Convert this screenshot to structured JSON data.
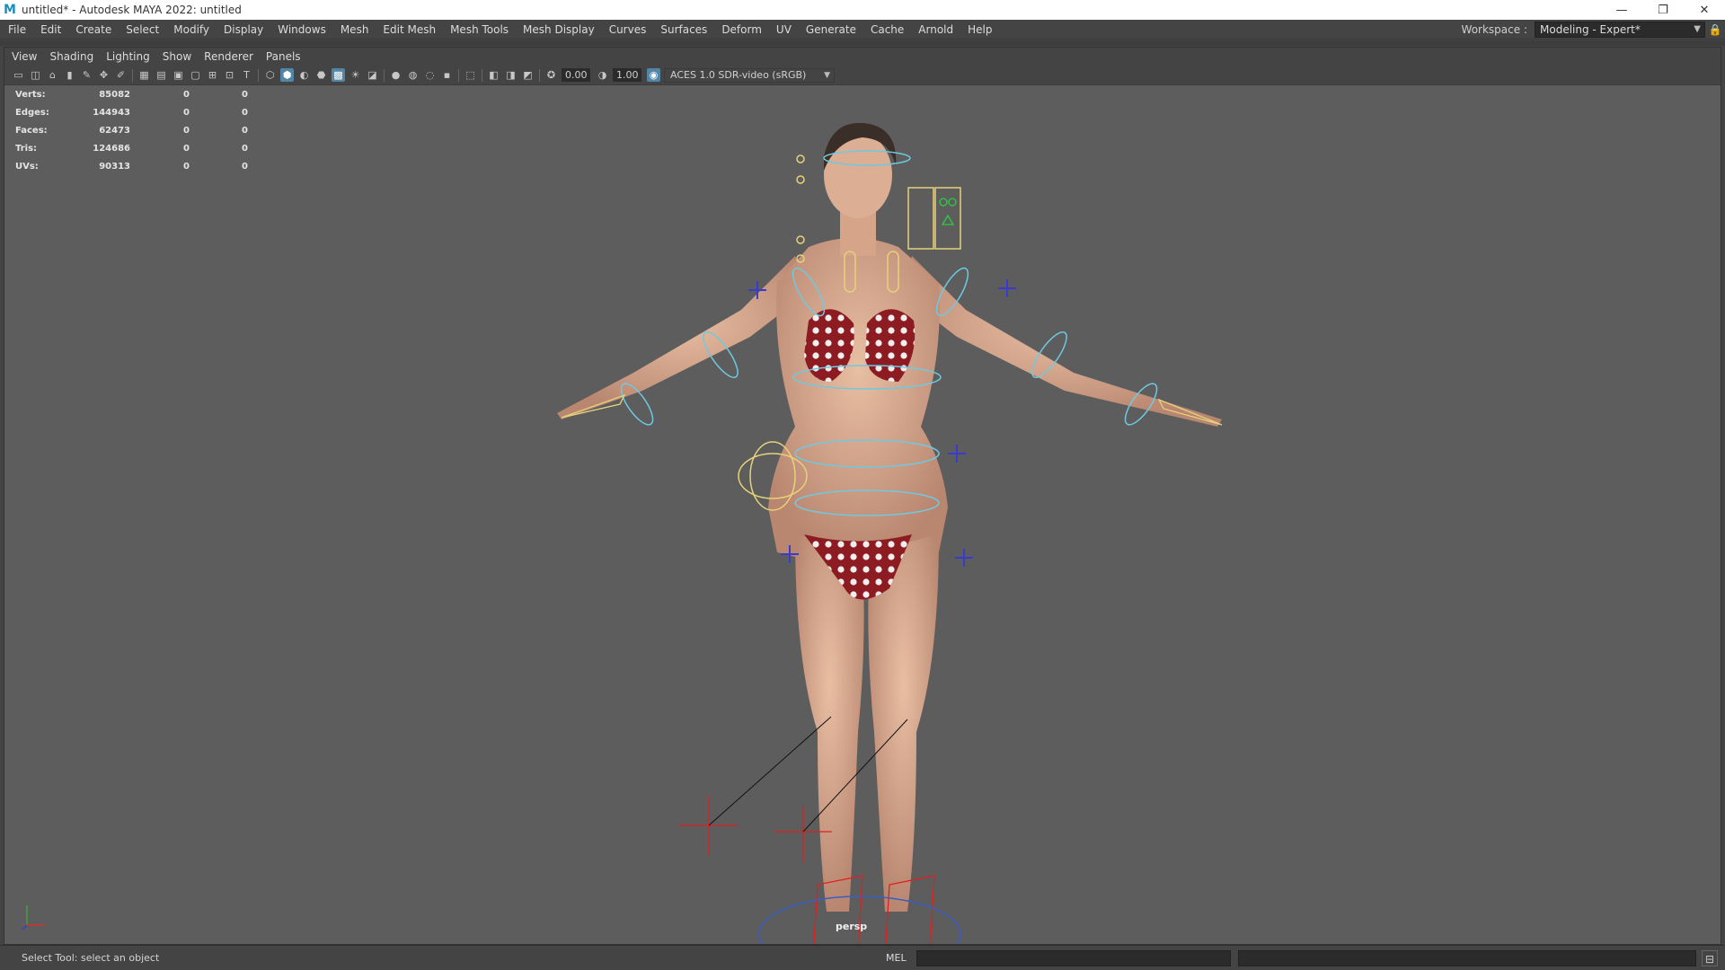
{
  "window": {
    "app_icon": "M",
    "title": "untitled* - Autodesk MAYA 2022: untitled",
    "minimize": "—",
    "maximize": "❐",
    "close": "✕"
  },
  "menubar": {
    "items": [
      "File",
      "Edit",
      "Create",
      "Select",
      "Modify",
      "Display",
      "Windows",
      "Mesh",
      "Edit Mesh",
      "Mesh Tools",
      "Mesh Display",
      "Curves",
      "Surfaces",
      "Deform",
      "UV",
      "Generate",
      "Cache",
      "Arnold",
      "Help"
    ],
    "workspace_label": "Workspace :",
    "workspace_value": "Modeling - Expert*",
    "lock_icon": "lock-icon"
  },
  "panel": {
    "menu": [
      "View",
      "Shading",
      "Lighting",
      "Show",
      "Renderer",
      "Panels"
    ],
    "toolbar": {
      "exposure": "0.00",
      "gamma": "1.00",
      "color_space": "ACES 1.0 SDR-video (sRGB)"
    }
  },
  "hud": {
    "rows": [
      {
        "label": "Verts:",
        "v1": "85082",
        "v2": "0",
        "v3": "0"
      },
      {
        "label": "Edges:",
        "v1": "144943",
        "v2": "0",
        "v3": "0"
      },
      {
        "label": "Faces:",
        "v1": "62473",
        "v2": "0",
        "v3": "0"
      },
      {
        "label": "Tris:",
        "v1": "124686",
        "v2": "0",
        "v3": "0"
      },
      {
        "label": "UVs:",
        "v1": "90313",
        "v2": "0",
        "v3": "0"
      }
    ]
  },
  "viewport": {
    "camera": "persp",
    "skin_color": "#d9a98c",
    "bikini_color": "#8c1c22",
    "control_cyan": "#6fc9e0",
    "control_yellow": "#e6d27a",
    "control_blue": "#3a3ad0",
    "control_red": "#e02020"
  },
  "statusbar": {
    "help_text": "Select Tool: select an object",
    "mel_label": "MEL"
  }
}
